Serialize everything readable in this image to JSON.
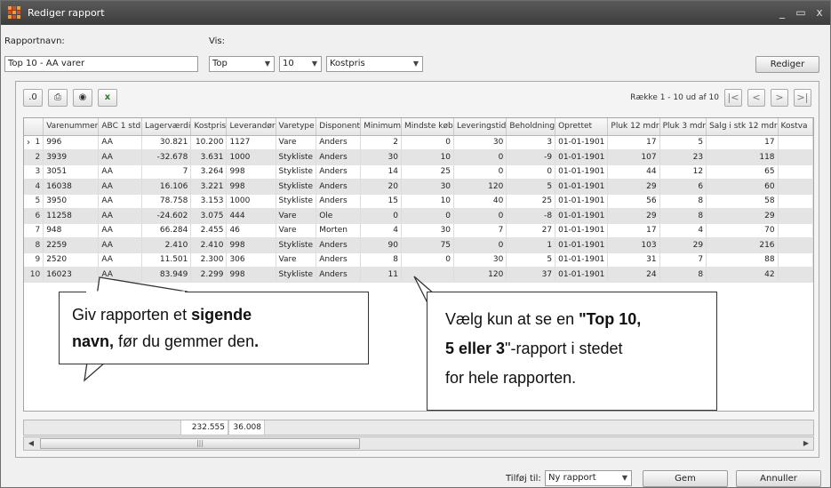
{
  "window": {
    "title": "Rediger rapport",
    "controls": [
      "_",
      "▭",
      "x"
    ]
  },
  "form": {
    "report_name_label": "Rapportnavn:",
    "report_name_value": "Top 10 - AA varer",
    "view_label": "Vis:",
    "view_select": "Top",
    "count_select": "10",
    "sort_select": "Kostpris",
    "edit_button": "Rediger"
  },
  "toolbar": {
    "decimal_label": ".0",
    "row_info": "Række 1 - 10 ud af 10",
    "nav": [
      "|<",
      "<",
      ">",
      ">|"
    ]
  },
  "grid": {
    "columns": [
      "",
      "Varenummer",
      "ABC 1 std",
      "Lagerværdi",
      "Kostpris",
      "Leverandør",
      "Varetype",
      "Disponent",
      "Minimum",
      "Mindste køb",
      "Leveringstid",
      "Beholdning",
      "Oprettet",
      "Pluk 12 mdr",
      "Pluk 3 mdr",
      "Salg i stk 12 mdr",
      "Kostva"
    ],
    "rows": [
      [
        "1",
        "996",
        "AA",
        "30.821",
        "10.200",
        "1127",
        "Vare",
        "Anders",
        "2",
        "0",
        "30",
        "3",
        "01-01-1901",
        "17",
        "5",
        "17",
        ""
      ],
      [
        "2",
        "3939",
        "AA",
        "-32.678",
        "3.631",
        "1000",
        "Stykliste",
        "Anders",
        "30",
        "10",
        "0",
        "-9",
        "01-01-1901",
        "107",
        "23",
        "118",
        ""
      ],
      [
        "3",
        "3051",
        "AA",
        "7",
        "3.264",
        "998",
        "Stykliste",
        "Anders",
        "14",
        "25",
        "0",
        "0",
        "01-01-1901",
        "44",
        "12",
        "65",
        ""
      ],
      [
        "4",
        "16038",
        "AA",
        "16.106",
        "3.221",
        "998",
        "Stykliste",
        "Anders",
        "20",
        "30",
        "120",
        "5",
        "01-01-1901",
        "29",
        "6",
        "60",
        ""
      ],
      [
        "5",
        "3950",
        "AA",
        "78.758",
        "3.153",
        "1000",
        "Stykliste",
        "Anders",
        "15",
        "10",
        "40",
        "25",
        "01-01-1901",
        "56",
        "8",
        "58",
        ""
      ],
      [
        "6",
        "11258",
        "AA",
        "-24.602",
        "3.075",
        "444",
        "Vare",
        "Ole",
        "0",
        "0",
        "0",
        "-8",
        "01-01-1901",
        "29",
        "8",
        "29",
        ""
      ],
      [
        "7",
        "948",
        "AA",
        "66.284",
        "2.455",
        "46",
        "Vare",
        "Morten",
        "4",
        "30",
        "7",
        "27",
        "01-01-1901",
        "17",
        "4",
        "70",
        ""
      ],
      [
        "8",
        "2259",
        "AA",
        "2.410",
        "2.410",
        "998",
        "Stykliste",
        "Anders",
        "90",
        "75",
        "0",
        "1",
        "01-01-1901",
        "103",
        "29",
        "216",
        ""
      ],
      [
        "9",
        "2520",
        "AA",
        "11.501",
        "2.300",
        "306",
        "Vare",
        "Anders",
        "8",
        "0",
        "30",
        "5",
        "01-01-1901",
        "31",
        "7",
        "88",
        ""
      ],
      [
        "10",
        "16023",
        "AA",
        "83.949",
        "2.299",
        "998",
        "Stykliste",
        "Anders",
        "11",
        "",
        "120",
        "37",
        "01-01-1901",
        "24",
        "8",
        "42",
        ""
      ]
    ],
    "footer_totals": {
      "lagervaerdi": "232.555",
      "kostpris": "36.008"
    }
  },
  "bottom": {
    "add_to_label": "Tilføj til:",
    "add_to_select": "Ny rapport",
    "save_button": "Gem",
    "cancel_button": "Annuller"
  },
  "callouts": {
    "left": {
      "line1_plain": "Giv rapporten et ",
      "line1_bold": "sigende",
      "line2_bold": "navn,",
      "line2_plain": " før du gemmer den",
      "line2_end": "."
    },
    "right": {
      "l1_plain": "Vælg kun at se en ",
      "l1_bold": "\"Top 10,",
      "l2_bold": "5 eller 3",
      "l2_plain": "\"-rapport i stedet",
      "l3": "for hele rapporten."
    }
  }
}
